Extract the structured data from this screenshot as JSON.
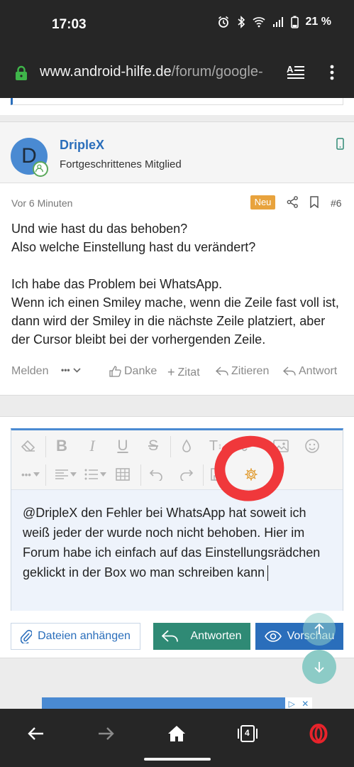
{
  "status_bar": {
    "time": "17:03",
    "battery": "21 %",
    "icons": [
      "alarm-icon",
      "bluetooth-icon",
      "wifi-icon",
      "signal-icon",
      "battery-icon"
    ]
  },
  "browser": {
    "url_domain": "www.android-hilfe.de",
    "url_path": "/forum/google-",
    "icons": [
      "lock-icon",
      "reader-mode-icon",
      "overflow-menu-icon"
    ]
  },
  "post": {
    "avatar_letter": "D",
    "author_name": "DripleX",
    "author_title": "Fortgeschrittenes Mitglied",
    "timestamp": "Vor 6 Minuten",
    "badge": "Neu",
    "number": "#6",
    "body": [
      "Und wie hast du das behoben?",
      "Also welche Einstellung hast du verändert?",
      "",
      "Ich habe das Problem bei WhatsApp.",
      "Wenn ich einen Smiley mache, wenn die Zeile fast voll ist, dann wird der Smiley in die nächste Zeile platziert, aber der Cursor bleibt bei der vorhergenden Zeile."
    ],
    "actions": {
      "report": "Melden",
      "more": "•••",
      "thanks": "Danke",
      "quote": "Zitat",
      "cite": "Zitieren",
      "reply": "Antwort"
    }
  },
  "editor": {
    "text": "@DripleX den Fehler bei WhatsApp hat soweit ich weiß jeder der wurde noch nicht behoben. Hier im Forum habe ich einfach auf das Einstellungsrädchen geklickt in der Box wo man schreiben kann",
    "toolbar": [
      "eraser-icon",
      "bold-icon",
      "italic-icon",
      "underline-icon",
      "strikethrough-icon",
      "color-icon",
      "text-size-icon",
      "link-icon",
      "image-icon",
      "emoji-icon",
      "more-icon",
      "align-icon",
      "list-icon",
      "table-icon",
      "undo-icon",
      "redo-icon",
      "save-draft-icon",
      "settings-gear-icon"
    ]
  },
  "buttons": {
    "attach": "Dateien anhängen",
    "reply": "Antworten",
    "preview": "Vorschau"
  },
  "nav": {
    "tabs_count": "4"
  },
  "colors": {
    "link_blue": "#2a6ebb",
    "badge_orange": "#e8a33d",
    "reply_green": "#2f8a75",
    "annotation_red": "#f0383b"
  }
}
